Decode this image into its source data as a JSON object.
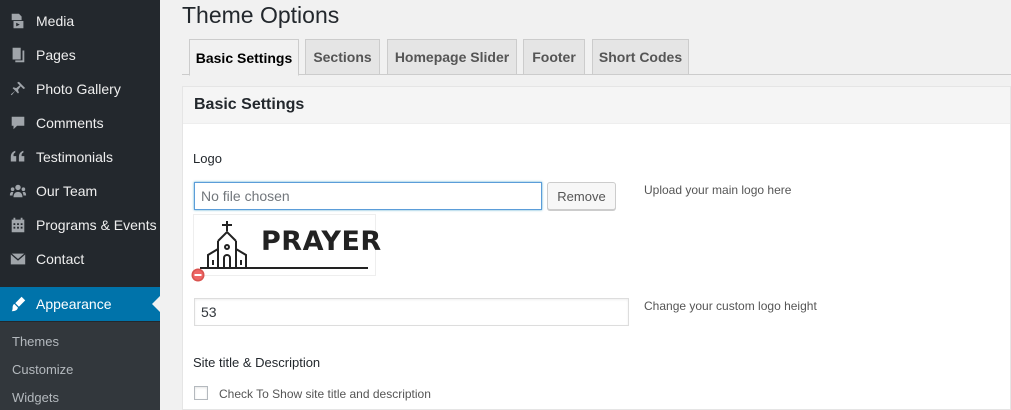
{
  "sidebar": {
    "items": [
      {
        "label": "Media",
        "icon": "media-icon"
      },
      {
        "label": "Pages",
        "icon": "pages-icon"
      },
      {
        "label": "Photo Gallery",
        "icon": "pin-icon"
      },
      {
        "label": "Comments",
        "icon": "comments-icon"
      },
      {
        "label": "Testimonials",
        "icon": "quote-icon"
      },
      {
        "label": "Our Team",
        "icon": "team-icon"
      },
      {
        "label": "Programs & Events",
        "icon": "calendar-icon"
      },
      {
        "label": "Contact",
        "icon": "envelope-icon"
      },
      {
        "label": "Appearance",
        "icon": "brush-icon"
      }
    ],
    "submenu": [
      "Themes",
      "Customize",
      "Widgets"
    ]
  },
  "page": {
    "title": "Theme Options"
  },
  "tabs": [
    "Basic Settings",
    "Sections",
    "Homepage Slider",
    "Footer",
    "Short Codes"
  ],
  "panel": {
    "title": "Basic Settings",
    "logo": {
      "label": "Logo",
      "placeholder": "No file chosen",
      "remove_label": "Remove",
      "description": "Upload your main logo here",
      "preview_text": "PRAYER"
    },
    "logo_height": {
      "value": "53",
      "description": "Change your custom logo height"
    },
    "site_title": {
      "label": "Site title & Description",
      "checkbox_label": "Check To Show site title and description"
    }
  },
  "colors": {
    "sidebar_bg": "#23282d",
    "accent": "#0073aa"
  }
}
